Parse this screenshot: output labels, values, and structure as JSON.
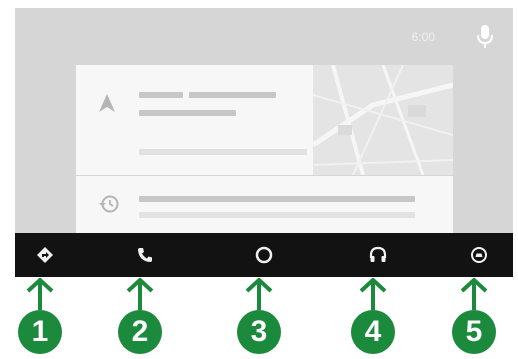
{
  "status_bar": {
    "time": "6:00",
    "mic_icon": "microphone-icon"
  },
  "cards": {
    "navigation_card_icon": "navigation-arrow-icon",
    "history_card_icon": "history-clock-icon"
  },
  "nav_bar": {
    "items": [
      {
        "icon": "navigation-icon"
      },
      {
        "icon": "phone-icon"
      },
      {
        "icon": "home-circle-icon"
      },
      {
        "icon": "headphones-icon"
      },
      {
        "icon": "car-exit-icon"
      }
    ]
  },
  "callouts": [
    "1",
    "2",
    "3",
    "4",
    "5"
  ],
  "colors": {
    "callout_green": "#1b8a3c",
    "nav_bar": "#121212",
    "screen_bg": "#d6d6d6"
  }
}
